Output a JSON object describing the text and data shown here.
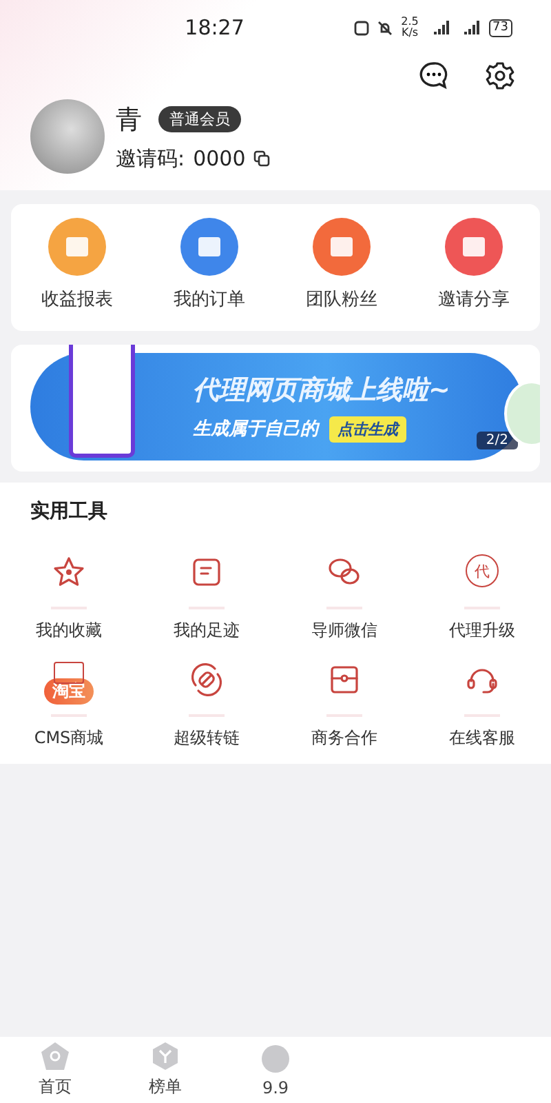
{
  "status_bar": {
    "time": "18:27",
    "speed": "2.5 K/s",
    "battery": "73"
  },
  "profile": {
    "name": "青",
    "badge": "普通会员",
    "invite_label": "邀请码:",
    "invite_code": "0000"
  },
  "quick_menu": [
    {
      "label": "收益报表",
      "color": "#f5a442"
    },
    {
      "label": "我的订单",
      "color": "#3f86ea"
    },
    {
      "label": "团队粉丝",
      "color": "#f26a3c"
    },
    {
      "label": "邀请分享",
      "color": "#ee5656"
    }
  ],
  "banner": {
    "headline": "代理网页商城上线啦~",
    "subline": "生成属于自己的",
    "cta": "点击生成",
    "counter": "2/2"
  },
  "tools": {
    "title": "实用工具",
    "items": [
      {
        "label": "我的收藏",
        "kind": "star"
      },
      {
        "label": "我的足迹",
        "kind": "note"
      },
      {
        "label": "导师微信",
        "kind": "chat"
      },
      {
        "label": "代理升级",
        "kind": "agent",
        "glyph": "代"
      },
      {
        "label": "CMS商城",
        "kind": "taobao",
        "glyph": "淘宝"
      },
      {
        "label": "超级转链",
        "kind": "link"
      },
      {
        "label": "商务合作",
        "kind": "case"
      },
      {
        "label": "在线客服",
        "kind": "headset"
      }
    ]
  },
  "tab_bar": [
    {
      "label": "首页",
      "kind": "home"
    },
    {
      "label": "榜单",
      "kind": "rank"
    },
    {
      "label": "9.9",
      "kind": "deal"
    }
  ]
}
